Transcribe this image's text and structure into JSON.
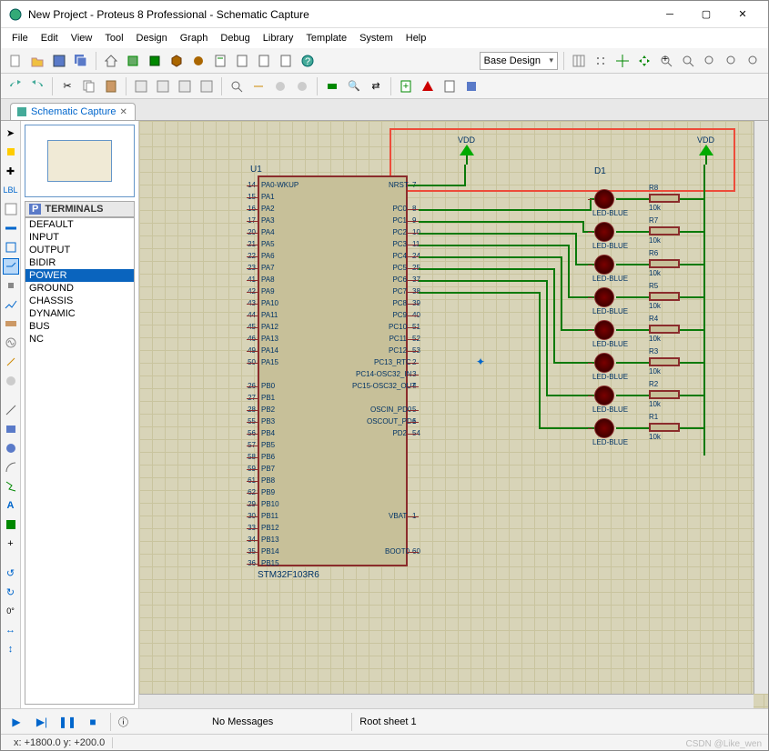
{
  "window": {
    "title": "New Project - Proteus 8 Professional - Schematic Capture"
  },
  "menu": {
    "items": [
      "File",
      "Edit",
      "View",
      "Tool",
      "Design",
      "Graph",
      "Debug",
      "Library",
      "Template",
      "System",
      "Help"
    ]
  },
  "toolbar1": {
    "design_combo": "Base Design"
  },
  "tab": {
    "name": "Schematic Capture"
  },
  "terminals": {
    "header": "TERMINALS",
    "items": [
      "DEFAULT",
      "INPUT",
      "OUTPUT",
      "BIDIR",
      "POWER",
      "GROUND",
      "CHASSIS",
      "DYNAMIC",
      "BUS",
      "NC"
    ],
    "selected_index": 4
  },
  "schematic": {
    "chip_ref": "U1",
    "chip_part": "STM32F103R6",
    "vdd_label": "VDD",
    "led_ref": "D1",
    "led_part": "LED-BLUE",
    "resistors": [
      "R8",
      "R7",
      "R6",
      "R5",
      "R4",
      "R3",
      "R2",
      "R1"
    ],
    "res_value": "10k",
    "left_pins": [
      {
        "n": "14",
        "name": "PA0-WKUP"
      },
      {
        "n": "15",
        "name": "PA1"
      },
      {
        "n": "16",
        "name": "PA2"
      },
      {
        "n": "17",
        "name": "PA3"
      },
      {
        "n": "20",
        "name": "PA4"
      },
      {
        "n": "21",
        "name": "PA5"
      },
      {
        "n": "22",
        "name": "PA6"
      },
      {
        "n": "23",
        "name": "PA7"
      },
      {
        "n": "41",
        "name": "PA8"
      },
      {
        "n": "42",
        "name": "PA9"
      },
      {
        "n": "43",
        "name": "PA10"
      },
      {
        "n": "44",
        "name": "PA11"
      },
      {
        "n": "45",
        "name": "PA12"
      },
      {
        "n": "46",
        "name": "PA13"
      },
      {
        "n": "49",
        "name": "PA14"
      },
      {
        "n": "50",
        "name": "PA15"
      },
      {
        "n": "",
        "name": ""
      },
      {
        "n": "26",
        "name": "PB0"
      },
      {
        "n": "27",
        "name": "PB1"
      },
      {
        "n": "28",
        "name": "PB2"
      },
      {
        "n": "55",
        "name": "PB3"
      },
      {
        "n": "56",
        "name": "PB4"
      },
      {
        "n": "57",
        "name": "PB5"
      },
      {
        "n": "58",
        "name": "PB6"
      },
      {
        "n": "59",
        "name": "PB7"
      },
      {
        "n": "61",
        "name": "PB8"
      },
      {
        "n": "62",
        "name": "PB9"
      },
      {
        "n": "29",
        "name": "PB10"
      },
      {
        "n": "30",
        "name": "PB11"
      },
      {
        "n": "33",
        "name": "PB12"
      },
      {
        "n": "34",
        "name": "PB13"
      },
      {
        "n": "35",
        "name": "PB14"
      },
      {
        "n": "36",
        "name": "PB15"
      }
    ],
    "right_pins_a": [
      {
        "n": "7",
        "name": "NRST"
      },
      {
        "n": "",
        "name": ""
      },
      {
        "n": "8",
        "name": "PC0"
      },
      {
        "n": "9",
        "name": "PC1"
      },
      {
        "n": "10",
        "name": "PC2"
      },
      {
        "n": "11",
        "name": "PC3"
      },
      {
        "n": "24",
        "name": "PC4"
      },
      {
        "n": "25",
        "name": "PC5"
      },
      {
        "n": "37",
        "name": "PC6"
      },
      {
        "n": "38",
        "name": "PC7"
      },
      {
        "n": "39",
        "name": "PC8"
      },
      {
        "n": "40",
        "name": "PC9"
      },
      {
        "n": "51",
        "name": "PC10"
      },
      {
        "n": "52",
        "name": "PC11"
      },
      {
        "n": "53",
        "name": "PC12"
      },
      {
        "n": "2",
        "name": "PC13_RTC"
      },
      {
        "n": "3",
        "name": "PC14-OSC32_IN"
      },
      {
        "n": "4",
        "name": "PC15-OSC32_OUT"
      },
      {
        "n": "",
        "name": ""
      },
      {
        "n": "5",
        "name": "OSCIN_PD0"
      },
      {
        "n": "6",
        "name": "OSCOUT_PD1"
      },
      {
        "n": "54",
        "name": "PD2"
      },
      {
        "n": "",
        "name": ""
      },
      {
        "n": "",
        "name": ""
      },
      {
        "n": "",
        "name": ""
      },
      {
        "n": "",
        "name": ""
      },
      {
        "n": "",
        "name": ""
      },
      {
        "n": "",
        "name": ""
      },
      {
        "n": "1",
        "name": "VBAT"
      },
      {
        "n": "",
        "name": ""
      },
      {
        "n": "",
        "name": ""
      },
      {
        "n": "60",
        "name": "BOOT0"
      }
    ]
  },
  "bottom": {
    "messages": "No Messages",
    "sheet": "Root sheet 1"
  },
  "status": {
    "coords": "x:   +1800.0  y:    +200.0"
  },
  "lefttools": {
    "deg": "0°"
  },
  "watermark": "CSDN @Like_wen"
}
